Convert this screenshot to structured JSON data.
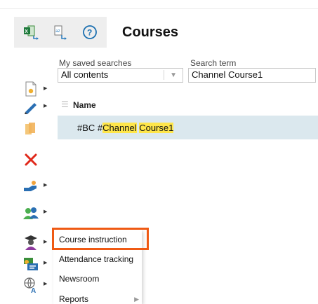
{
  "header": {
    "title": "Courses"
  },
  "toolbar": {
    "items": [
      {
        "icon": "excel-export-icon"
      },
      {
        "icon": "az-export-icon"
      },
      {
        "icon": "help-icon"
      }
    ]
  },
  "search": {
    "saved_label": "My saved searches",
    "saved_value": "All contents",
    "term_label": "Search term",
    "term_value": "Channel Course1"
  },
  "table": {
    "column": "Name",
    "rows": [
      {
        "prefix": "#BC #",
        "match1": "Channel",
        "space": " ",
        "match2": "Course1"
      }
    ]
  },
  "sidebar": {
    "icons": [
      "new-document-icon",
      "edit-pencil-icon",
      "copy-icon",
      "delete-icon",
      "hand-share-icon",
      "users-group-icon",
      "graduate-icon",
      "contact-card-icon",
      "globe-language-icon"
    ]
  },
  "menu": {
    "items": [
      {
        "label": "Course instruction",
        "highlighted": true
      },
      {
        "label": "Attendance tracking"
      },
      {
        "label": "Newsroom"
      },
      {
        "label": "Reports",
        "has_submenu": true
      }
    ]
  },
  "colors": {
    "highlight": "#ffe64a",
    "selected_row": "#dbe8ee",
    "callout": "#ef5a14"
  }
}
